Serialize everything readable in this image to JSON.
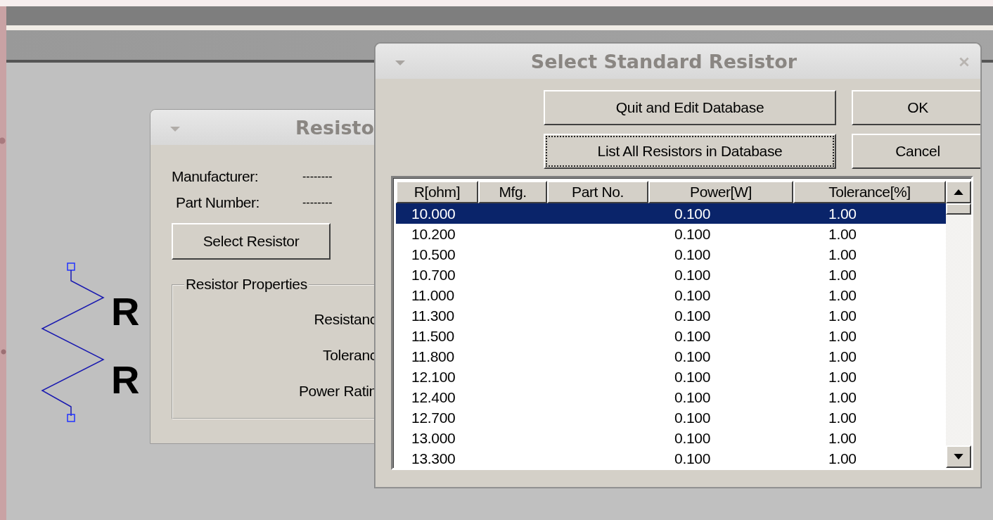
{
  "schematic": {
    "labels": [
      "R",
      "R"
    ]
  },
  "resistor_dialog": {
    "title": "Resisto",
    "manufacturer_label": "Manufacturer:",
    "manufacturer_value": "--------",
    "part_number_label": "Part Number:",
    "part_number_value": "--------",
    "select_button": "Select Resistor",
    "group_title": "Resistor Properties",
    "properties": [
      "Resistanc",
      "Toleranc",
      "Power Ratin"
    ]
  },
  "select_dialog": {
    "title": "Select Standard Resistor",
    "buttons": [
      {
        "label": "Quit and Edit Database",
        "focused": false
      },
      {
        "label": "OK",
        "focused": false
      },
      {
        "label": "List All Resistors in Database",
        "focused": true
      },
      {
        "label": "Cancel",
        "focused": false
      }
    ],
    "table": {
      "columns": [
        "R[ohm]",
        "Mfg.",
        "Part No.",
        "Power[W]",
        "Tolerance[%]"
      ],
      "rows": [
        {
          "r": "10.000",
          "power": "0.100",
          "tolerance": "1.00",
          "selected": true
        },
        {
          "r": "10.200",
          "power": "0.100",
          "tolerance": "1.00",
          "selected": false
        },
        {
          "r": "10.500",
          "power": "0.100",
          "tolerance": "1.00",
          "selected": false
        },
        {
          "r": "10.700",
          "power": "0.100",
          "tolerance": "1.00",
          "selected": false
        },
        {
          "r": "11.000",
          "power": "0.100",
          "tolerance": "1.00",
          "selected": false
        },
        {
          "r": "11.300",
          "power": "0.100",
          "tolerance": "1.00",
          "selected": false
        },
        {
          "r": "11.500",
          "power": "0.100",
          "tolerance": "1.00",
          "selected": false
        },
        {
          "r": "11.800",
          "power": "0.100",
          "tolerance": "1.00",
          "selected": false
        },
        {
          "r": "12.100",
          "power": "0.100",
          "tolerance": "1.00",
          "selected": false
        },
        {
          "r": "12.400",
          "power": "0.100",
          "tolerance": "1.00",
          "selected": false
        },
        {
          "r": "12.700",
          "power": "0.100",
          "tolerance": "1.00",
          "selected": false
        },
        {
          "r": "13.000",
          "power": "0.100",
          "tolerance": "1.00",
          "selected": false
        },
        {
          "r": "13.300",
          "power": "0.100",
          "tolerance": "1.00",
          "selected": false
        }
      ]
    }
  }
}
